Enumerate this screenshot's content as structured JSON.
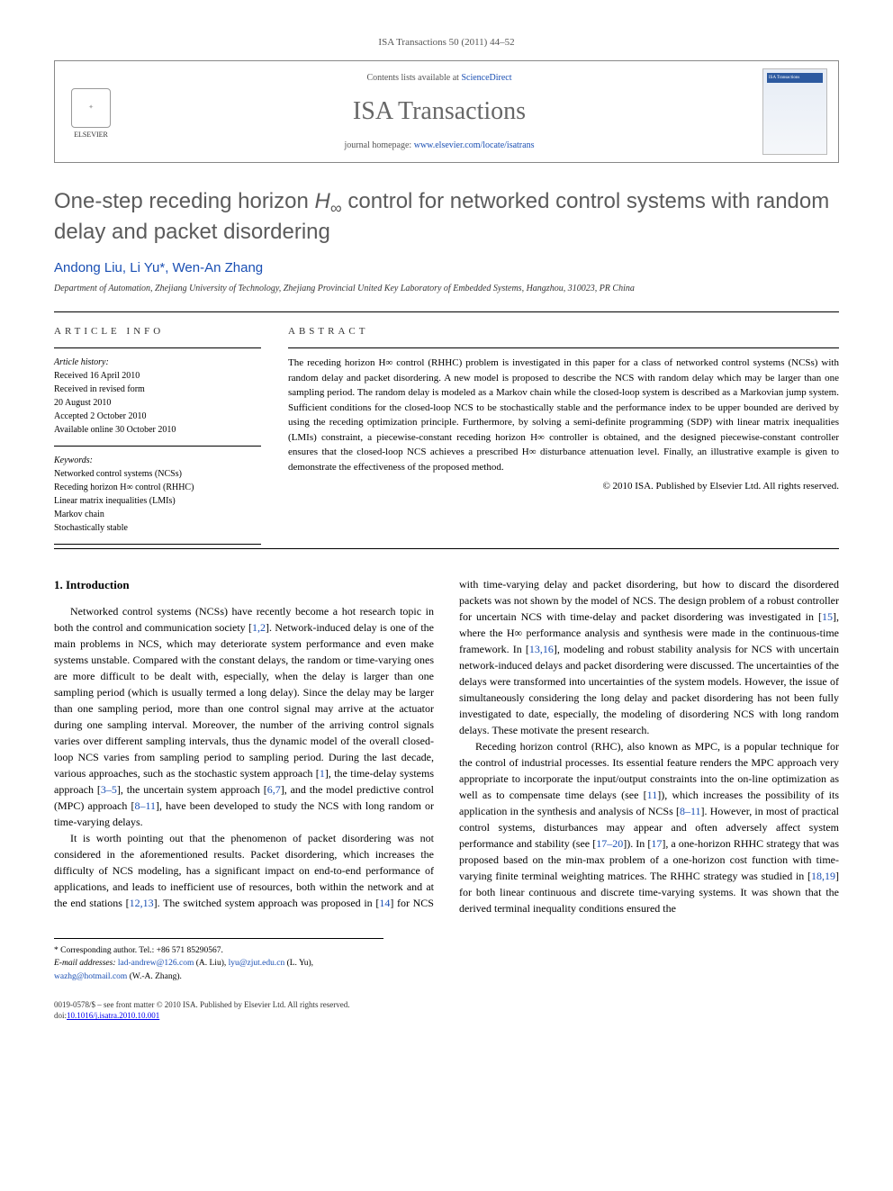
{
  "journal_ref": "ISA Transactions 50 (2011) 44–52",
  "header": {
    "contents_prefix": "Contents lists available at ",
    "contents_link": "ScienceDirect",
    "journal_name": "ISA Transactions",
    "homepage_prefix": "journal homepage: ",
    "homepage_link": "www.elsevier.com/locate/isatrans",
    "elsevier_label": "ELSEVIER"
  },
  "title_parts": {
    "p1": "One-step receding horizon ",
    "p2": "H",
    "p3": "∞",
    "p4": " control for networked control systems with random delay and packet disordering"
  },
  "authors": {
    "a1": "Andong Liu",
    "a2": "Li Yu",
    "a2_mark": "*",
    "a3": "Wen-An Zhang",
    "sep": ", "
  },
  "affiliation": "Department of Automation, Zhejiang University of Technology, Zhejiang Provincial United Key Laboratory of Embedded Systems, Hangzhou, 310023, PR China",
  "info": {
    "heading": "article info",
    "history_label": "Article history:",
    "history": [
      "Received 16 April 2010",
      "Received in revised form",
      "20 August 2010",
      "Accepted 2 October 2010",
      "Available online 30 October 2010"
    ],
    "keywords_label": "Keywords:",
    "keywords": [
      "Networked control systems (NCSs)",
      "Receding horizon H∞ control (RHHC)",
      "Linear matrix inequalities (LMIs)",
      "Markov chain",
      "Stochastically stable"
    ]
  },
  "abstract": {
    "heading": "abstract",
    "text": "The receding horizon H∞ control (RHHC) problem is investigated in this paper for a class of networked control systems (NCSs) with random delay and packet disordering. A new model is proposed to describe the NCS with random delay which may be larger than one sampling period. The random delay is modeled as a Markov chain while the closed-loop system is described as a Markovian jump system. Sufficient conditions for the closed-loop NCS to be stochastically stable and the performance index to be upper bounded are derived by using the receding optimization principle. Furthermore, by solving a semi-definite programming (SDP) with linear matrix inequalities (LMIs) constraint, a piecewise-constant receding horizon H∞ controller is obtained, and the designed piecewise-constant controller ensures that the closed-loop NCS achieves a prescribed H∞ disturbance attenuation level. Finally, an illustrative example is given to demonstrate the effectiveness of the proposed method.",
    "copyright": "© 2010 ISA. Published by Elsevier Ltd. All rights reserved."
  },
  "section1": {
    "heading": "1. Introduction",
    "para1_a": "Networked control systems (NCSs) have recently become a hot research topic in both the control and communication society [",
    "para1_b": "]. Network-induced delay is one of the main problems in NCS, which may deteriorate system performance and even make systems unstable. Compared with the constant delays, the random or time-varying ones are more difficult to be dealt with, especially, when the delay is larger than one sampling period (which is usually termed a long delay). Since the delay may be larger than one sampling period, more than one control signal may arrive at the actuator during one sampling interval. Moreover, the number of the arriving control signals varies over different sampling intervals, thus the dynamic model of the overall closed-loop NCS varies from sampling period to sampling period. During the last decade, various approaches, such as the stochastic system approach [",
    "para1_c": "], the time-delay systems approach [",
    "para1_d": "], the uncertain system approach [",
    "para1_e": "], and the model predictive control (MPC) approach [",
    "para1_f": "], have been developed to study the NCS with long random or time-varying delays.",
    "para2_a": "It is worth pointing out that the phenomenon of packet disordering was not considered in the aforementioned results. Packet disordering, which increases the difficulty of NCS modeling, has a significant impact on end-to-end performance of applications, ",
    "para2_b": "and leads to inefficient use of resources, both within the network and at the end stations [",
    "para2_c": "]. The switched system approach was proposed in [",
    "para2_d": "] for NCS with time-varying delay and packet disordering, but how to discard the disordered packets was not shown by the model of NCS. The design problem of a robust controller for uncertain NCS with time-delay and packet disordering was investigated in [",
    "para2_e": "], where the H∞ performance analysis and synthesis were made in the continuous-time framework. In [",
    "para2_f": "], modeling and robust stability analysis for NCS with uncertain network-induced delays and packet disordering were discussed. The uncertainties of the delays were transformed into uncertainties of the system models. However, the issue of simultaneously considering the long delay and packet disordering has not been fully investigated to date, especially, the modeling of disordering NCS with long random delays. These motivate the present research.",
    "para3_a": "Receding horizon control (RHC), also known as MPC, is a popular technique for the control of industrial processes. Its essential feature renders the MPC approach very appropriate to incorporate the input/output constraints into the on-line optimization as well as to compensate time delays (see [",
    "para3_b": "]), which increases the possibility of its application in the synthesis and analysis of NCSs [",
    "para3_c": "]. However, in most of practical control systems, disturbances may appear and often adversely affect system performance and stability (see [",
    "para3_d": "]). In [",
    "para3_e": "], a one-horizon RHHC strategy that was proposed based on the min-max problem of a one-horizon cost function with time-varying finite terminal weighting matrices. The RHHC strategy was studied in [",
    "para3_f": "] for both linear continuous and discrete time-varying systems. It was shown that the derived terminal inequality conditions ensured the",
    "refs": {
      "r12": "1,2",
      "r1": "1",
      "r3_5": "3–5",
      "r6_7": "6,7",
      "r8_11": "8–11",
      "r12_13": "12,13",
      "r14": "14",
      "r15": "15",
      "r13_16": "13,16",
      "r11": "11",
      "r8_11b": "8–11",
      "r17_20": "17–20",
      "r17": "17",
      "r18_19": "18,19"
    }
  },
  "footnotes": {
    "corr_label": "* Corresponding author. Tel.: +86 571 85290567.",
    "email_label": "E-mail addresses:",
    "emails": [
      {
        "addr": "lad-andrew@126.com",
        "name": " (A. Liu), "
      },
      {
        "addr": "lyu@zjut.edu.cn",
        "name": " (L. Yu), "
      },
      {
        "addr": "wazhg@hotmail.com",
        "name": " (W.-A. Zhang)."
      }
    ]
  },
  "bottom": {
    "line1": "0019-0578/$ – see front matter © 2010 ISA. Published by Elsevier Ltd. All rights reserved.",
    "doi_label": "doi:",
    "doi": "10.1016/j.isatra.2010.10.001"
  }
}
